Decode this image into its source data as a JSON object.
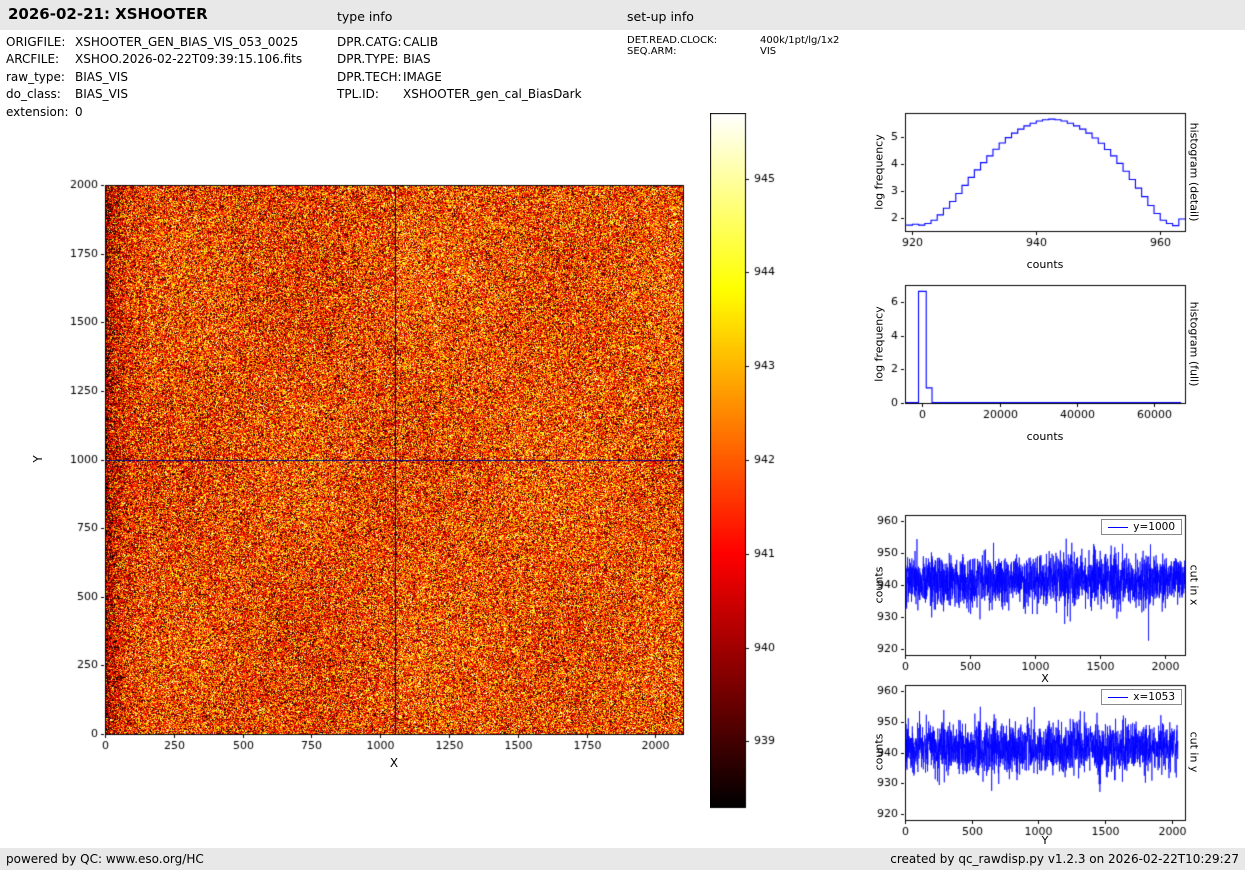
{
  "header": {
    "title": "2026-02-21: XSHOOTER",
    "type_info_label": "type info",
    "setup_info_label": "set-up info"
  },
  "metadata": {
    "file": [
      {
        "key": "ORIGFILE:",
        "value": "XSHOOTER_GEN_BIAS_VIS_053_0025"
      },
      {
        "key": "ARCFILE:",
        "value": "XSHOO.2026-02-22T09:39:15.106.fits"
      },
      {
        "key": "raw_type:",
        "value": "BIAS_VIS"
      },
      {
        "key": "do_class:",
        "value": "BIAS_VIS"
      },
      {
        "key": "extension:",
        "value": "0"
      }
    ],
    "type_info": [
      {
        "key": "DPR.CATG:",
        "value": "CALIB"
      },
      {
        "key": "DPR.TYPE:",
        "value": "BIAS"
      },
      {
        "key": "DPR.TECH:",
        "value": "IMAGE"
      },
      {
        "key": "TPL.ID:",
        "value": "XSHOOTER_gen_cal_BiasDark"
      }
    ],
    "setup_info": [
      {
        "key": "DET.READ.CLOCK:",
        "value": "400k/1pt/lg/1x2"
      },
      {
        "key": "SEQ.ARM:",
        "value": "VIS"
      }
    ]
  },
  "footer": {
    "left": "powered by QC: www.eso.org/HC",
    "right": "created by qc_rawdisp.py v1.2.3 on 2026-02-22T10:29:27"
  },
  "chart_data": [
    {
      "id": "bias-image",
      "type": "heatmap",
      "xlabel": "X",
      "ylabel": "Y",
      "xlim": [
        0,
        2100
      ],
      "ylim": [
        0,
        2000
      ],
      "xticks": [
        0,
        250,
        500,
        750,
        1000,
        1250,
        1500,
        1750,
        2000
      ],
      "yticks": [
        0,
        250,
        500,
        750,
        1000,
        1250,
        1500,
        1750,
        2000
      ],
      "colormap": "hot",
      "vmin": 938.3,
      "vmax": 945.7,
      "noise": {
        "mean": 941.6,
        "sigma": 1.7,
        "seed": 7
      },
      "crosshair": {
        "x": 1053,
        "y": 1000,
        "color": "#000080"
      },
      "colorbar": {
        "ticks": [
          939,
          940,
          941,
          942,
          943,
          944,
          945
        ]
      }
    },
    {
      "id": "histogram-detail",
      "type": "line",
      "style": "step",
      "color": "#0000ff",
      "side_label": "histogram (detail)",
      "xlabel": "counts",
      "ylabel": "log frequency",
      "xlim": [
        918.8,
        964
      ],
      "ylim": [
        1.5,
        5.9
      ],
      "xticks": [
        920,
        940,
        960
      ],
      "yticks": [
        2,
        3,
        4,
        5
      ],
      "bin_edges": [
        919,
        920,
        921,
        922,
        923,
        924,
        925,
        926,
        927,
        928,
        929,
        930,
        931,
        932,
        933,
        934,
        935,
        936,
        937,
        938,
        939,
        940,
        941,
        942,
        943,
        944,
        945,
        946,
        947,
        948,
        949,
        950,
        951,
        952,
        953,
        954,
        955,
        956,
        957,
        958,
        959,
        960,
        961,
        962,
        963,
        964
      ],
      "log_frequency": [
        1.72,
        1.75,
        1.72,
        1.78,
        1.9,
        2.1,
        2.35,
        2.6,
        2.9,
        3.2,
        3.5,
        3.78,
        4.05,
        4.3,
        4.55,
        4.78,
        4.98,
        5.15,
        5.3,
        5.42,
        5.52,
        5.6,
        5.65,
        5.67,
        5.65,
        5.6,
        5.52,
        5.42,
        5.3,
        5.15,
        4.97,
        4.77,
        4.54,
        4.3,
        4.02,
        3.73,
        3.42,
        3.1,
        2.78,
        2.45,
        2.15,
        1.9,
        1.78,
        1.7,
        1.95
      ]
    },
    {
      "id": "histogram-full",
      "type": "line",
      "style": "step",
      "color": "#0000ff",
      "side_label": "histogram (full)",
      "xlabel": "counts",
      "ylabel": "log frequency",
      "xlim": [
        -4500,
        68000
      ],
      "ylim": [
        0,
        7
      ],
      "xticks": [
        0,
        20000,
        40000,
        60000
      ],
      "yticks": [
        0,
        2,
        4,
        6
      ],
      "bin_edges": [
        -4500,
        -1000,
        1000,
        2500,
        67000
      ],
      "log_frequency": [
        0.02,
        6.62,
        0.9,
        0.02
      ]
    },
    {
      "id": "cut-in-x",
      "type": "line",
      "color": "#0000ff",
      "legend": "y=1000",
      "side_label": "cut in x",
      "xlabel": "X",
      "ylabel": "counts",
      "xlim": [
        0,
        2150
      ],
      "ylim": [
        918,
        962
      ],
      "xticks": [
        0,
        500,
        1000,
        1500,
        2000
      ],
      "yticks": [
        920,
        930,
        940,
        950,
        960
      ],
      "signal": {
        "mean": 941.5,
        "sigma": 4.0,
        "n": 2150,
        "x_step": 1,
        "seed": 101,
        "outliers": [
          {
            "x": 1870,
            "value": 922.5
          }
        ]
      }
    },
    {
      "id": "cut-in-y",
      "type": "line",
      "color": "#0000ff",
      "legend": "x=1053",
      "side_label": "cut in y",
      "xlabel": "Y",
      "ylabel": "counts",
      "xlim": [
        0,
        2100
      ],
      "ylim": [
        918,
        962
      ],
      "xticks": [
        0,
        500,
        1000,
        1500,
        2000
      ],
      "yticks": [
        920,
        930,
        940,
        950,
        960
      ],
      "signal": {
        "mean": 941.5,
        "sigma": 4.0,
        "n": 2048,
        "x_step": 1,
        "seed": 202,
        "outliers": [
          {
            "x": 650,
            "value": 927.5
          }
        ]
      }
    }
  ]
}
